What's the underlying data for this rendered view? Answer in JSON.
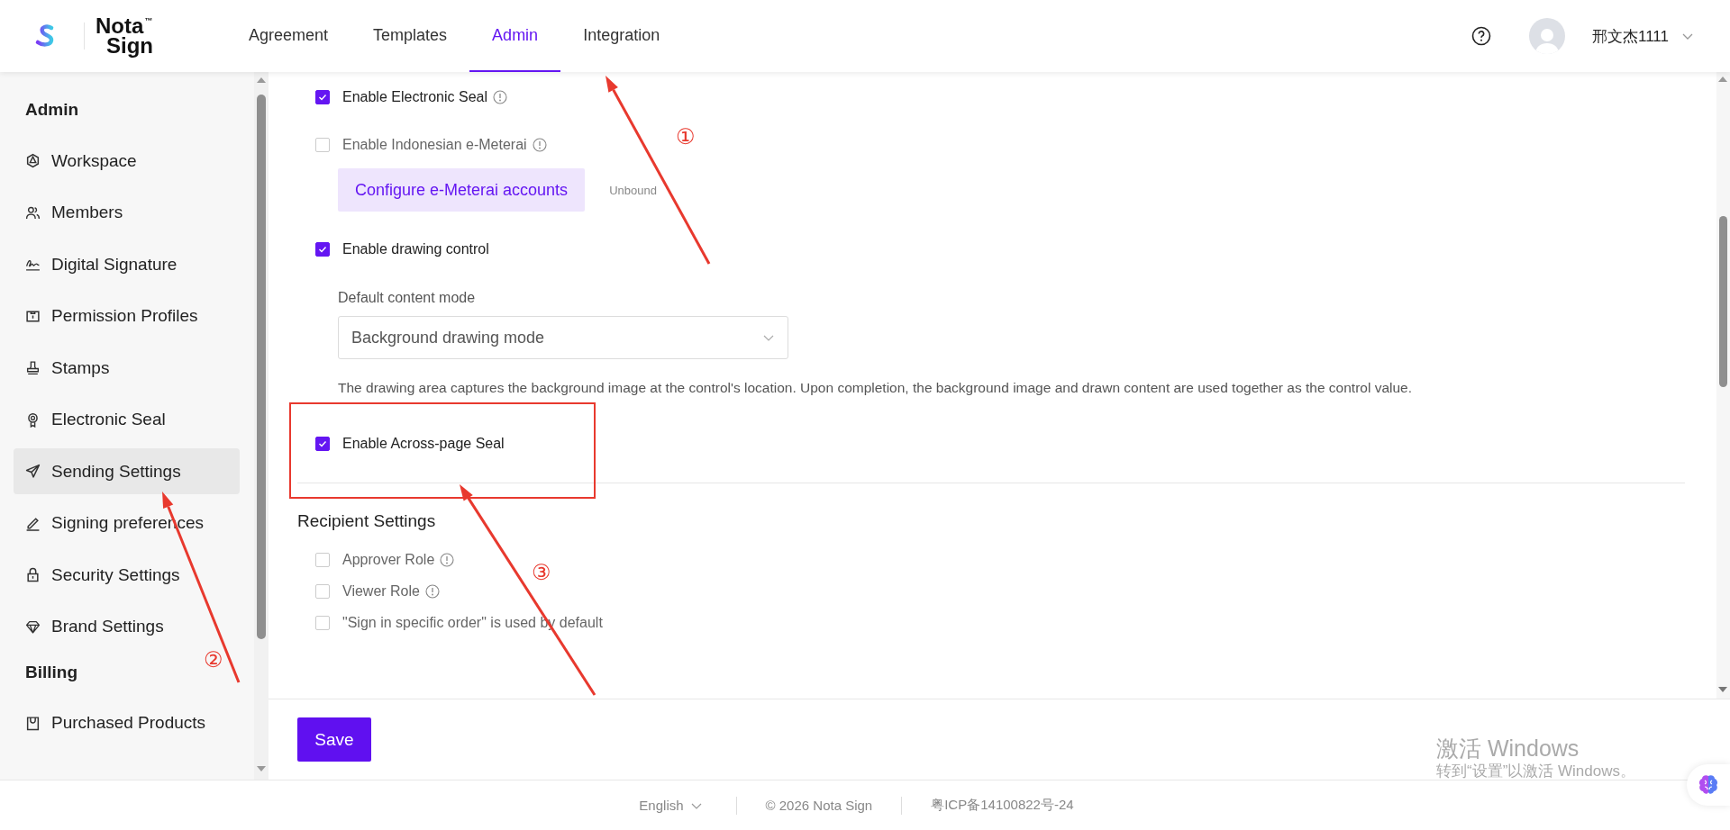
{
  "header": {
    "logo": {
      "line_1": "Nota",
      "line_2": "Sign",
      "mark": "™"
    },
    "tabs": [
      {
        "label": "Agreement",
        "selected": false
      },
      {
        "label": "Templates",
        "selected": false
      },
      {
        "label": "Admin",
        "selected": true
      },
      {
        "label": "Integration",
        "selected": false
      }
    ],
    "user": {
      "name": "邢文杰1111"
    }
  },
  "sidebar": {
    "sections": [
      {
        "title": "Admin",
        "items": [
          {
            "label": "Workspace",
            "selected": false
          },
          {
            "label": "Members",
            "selected": false
          },
          {
            "label": "Digital Signature",
            "selected": false
          },
          {
            "label": "Permission Profiles",
            "selected": false
          },
          {
            "label": "Stamps",
            "selected": false
          },
          {
            "label": "Electronic Seal",
            "selected": false
          },
          {
            "label": "Sending Settings",
            "selected": true
          },
          {
            "label": "Signing preferences",
            "selected": false
          },
          {
            "label": "Security Settings",
            "selected": false
          },
          {
            "label": "Brand Settings",
            "selected": false
          }
        ]
      },
      {
        "title": "Billing",
        "items": [
          {
            "label": "Purchased Products",
            "selected": false
          }
        ]
      }
    ]
  },
  "settings": {
    "sections": [
      {
        "items": [
          {
            "kind": "checkbox",
            "label": "Enable Electronic Seal",
            "checked": true,
            "info": true
          },
          {
            "kind": "checkbox",
            "label": "Enable Indonesian e-Meterai",
            "checked": false,
            "info": true
          },
          {
            "kind": "action",
            "button": "Configure e-Meterai accounts",
            "status": "Unbound"
          },
          {
            "kind": "checkbox",
            "label": "Enable drawing control",
            "checked": true
          },
          {
            "kind": "select",
            "label": "Default content mode",
            "value": "Background drawing mode",
            "help": "The drawing area captures the background image at the control's location. Upon completion, the background image and drawn content are used together as the control value."
          },
          {
            "kind": "checkbox",
            "label": "Enable Across-page Seal",
            "checked": true
          }
        ]
      },
      {
        "title": "Recipient Settings",
        "items": [
          {
            "kind": "checkbox",
            "label": "Approver Role",
            "checked": false,
            "info": true
          },
          {
            "kind": "checkbox",
            "label": "Viewer Role",
            "checked": false,
            "info": true
          },
          {
            "kind": "checkbox",
            "label": "\"Sign in specific order\" is used by default",
            "checked": false
          }
        ]
      }
    ],
    "save_button": "Save"
  },
  "footer": {
    "language": "English",
    "copyright": "© 2026 Nota Sign",
    "icp": "粤ICP备14100822号-24"
  },
  "os_watermark": {
    "title": "激活 Windows",
    "subtitle": "转到“设置”以激活 Windows。"
  },
  "annotations": [
    {
      "label": "①"
    },
    {
      "label": "②"
    },
    {
      "label": "③"
    }
  ]
}
